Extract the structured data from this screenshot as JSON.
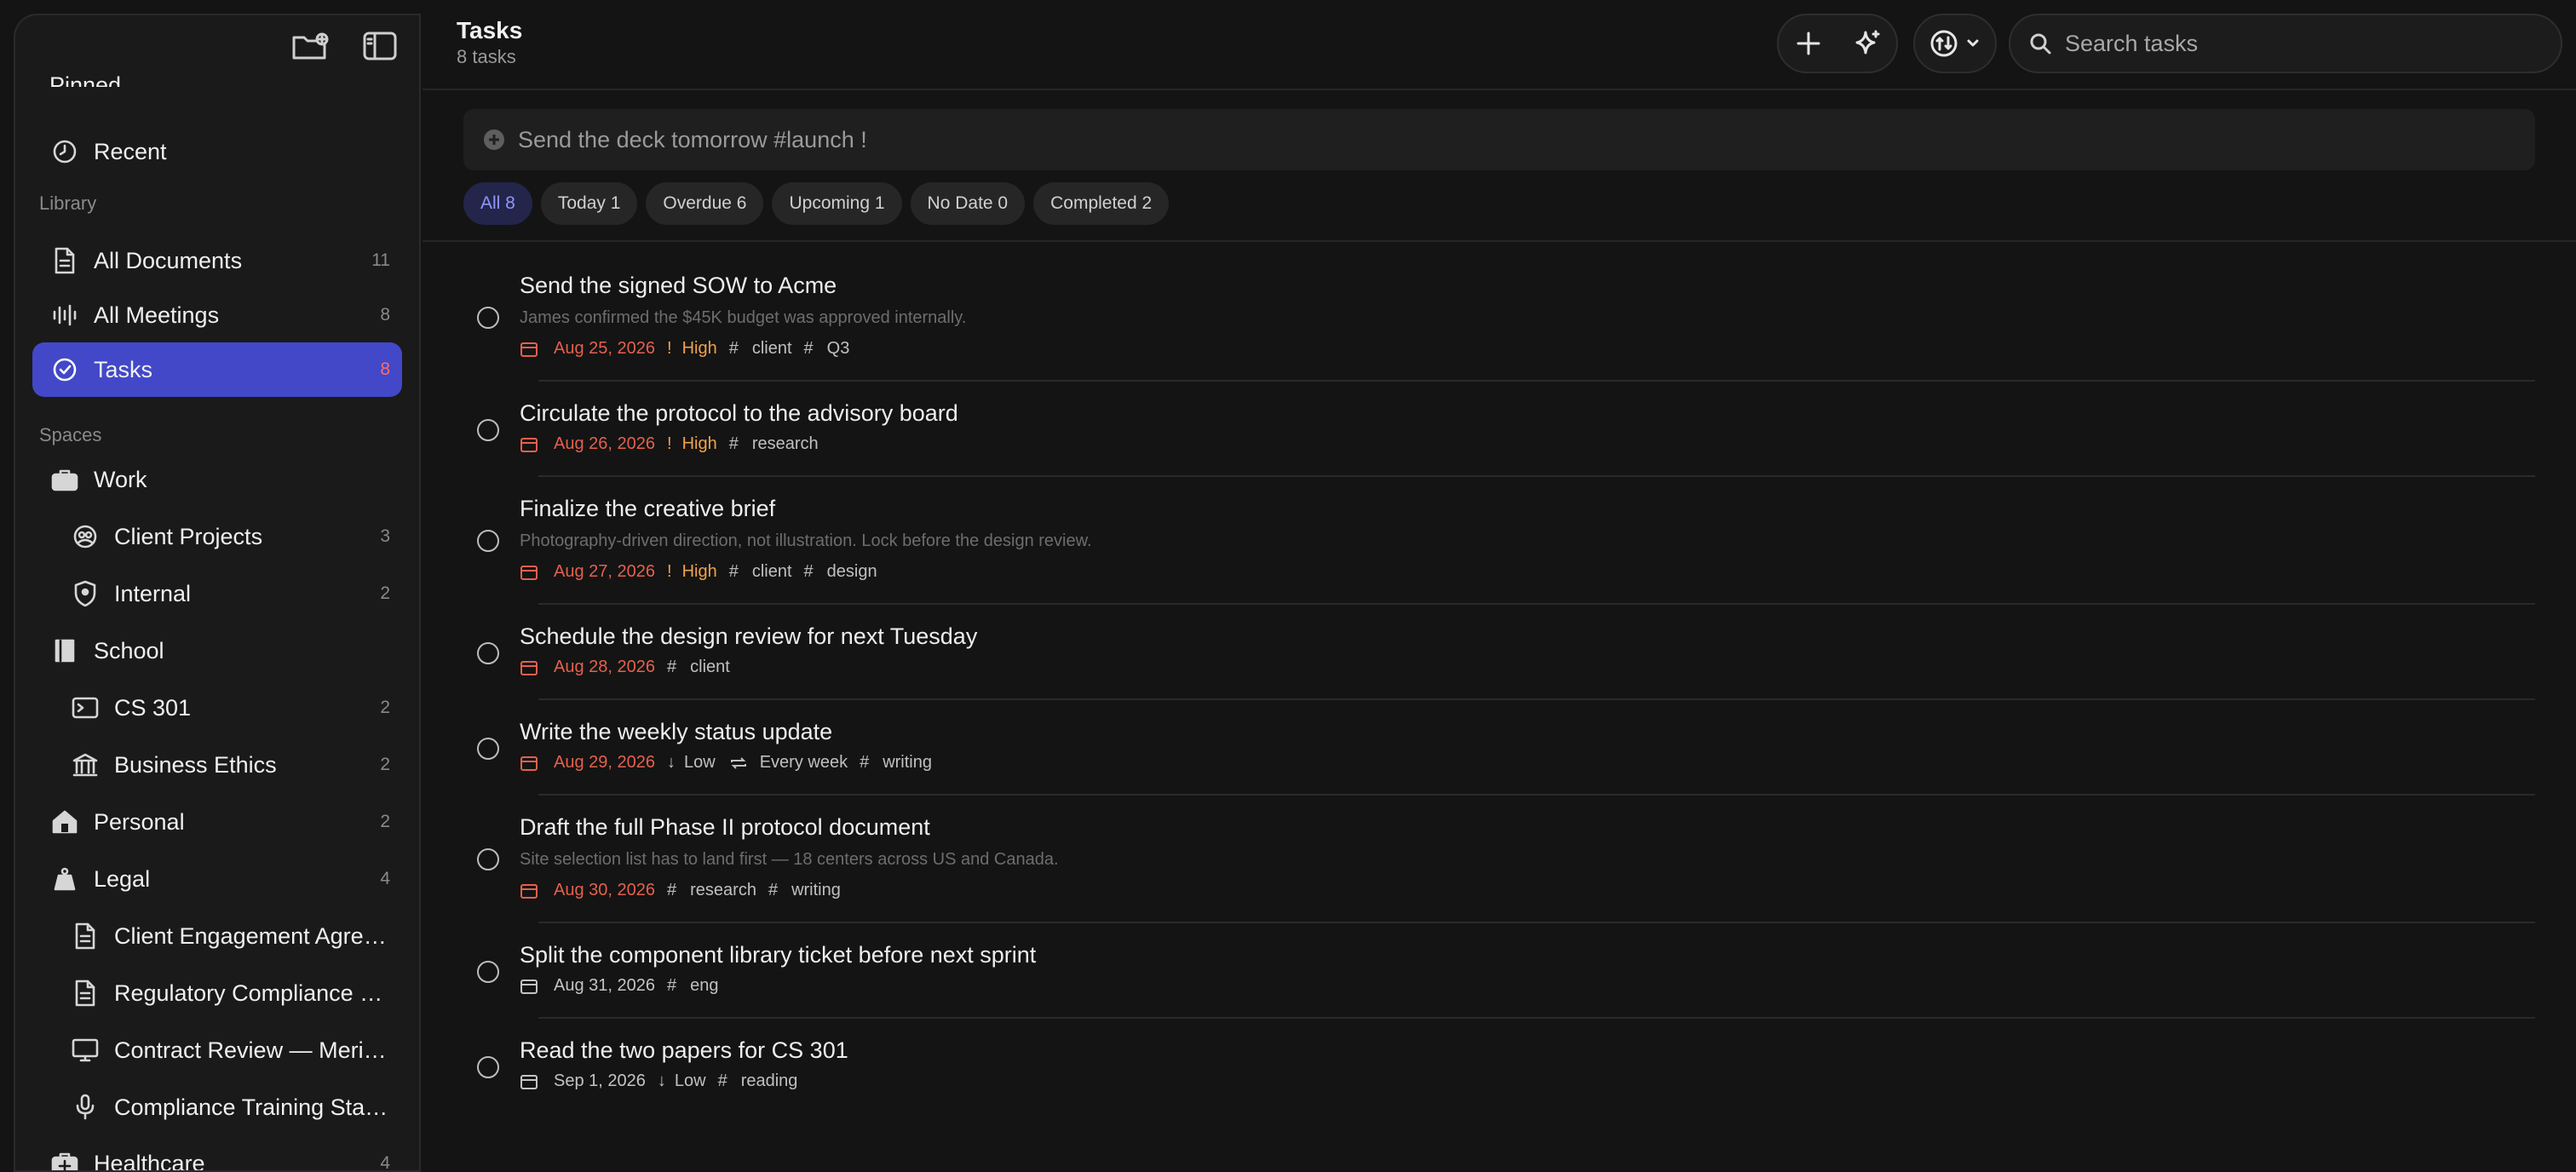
{
  "sidebar": {
    "top_partial_label": "Pinned",
    "recent": "Recent",
    "library_head": "Library",
    "library": [
      {
        "label": "All Documents",
        "count": "11"
      },
      {
        "label": "All Meetings",
        "count": "8"
      },
      {
        "label": "Tasks",
        "count": "8"
      }
    ],
    "spaces_head": "Spaces",
    "spaces": [
      {
        "label": "Work",
        "count": ""
      },
      {
        "label": "Client Projects",
        "count": "3"
      },
      {
        "label": "Internal",
        "count": "2"
      },
      {
        "label": "School",
        "count": ""
      },
      {
        "label": "CS 301",
        "count": "2"
      },
      {
        "label": "Business Ethics",
        "count": "2"
      },
      {
        "label": "Personal",
        "count": "2"
      },
      {
        "label": "Legal",
        "count": "4"
      },
      {
        "label": "Client Engagement Agreement",
        "count": ""
      },
      {
        "label": "Regulatory Compliance Checklist",
        "count": ""
      },
      {
        "label": "Contract Review — Meridian",
        "count": ""
      },
      {
        "label": "Compliance Training Standards",
        "count": ""
      },
      {
        "label": "Healthcare",
        "count": "4"
      }
    ]
  },
  "header": {
    "title": "Tasks",
    "subtitle": "8 tasks",
    "search_placeholder": "Search tasks"
  },
  "quick_add": {
    "text": "Send the deck tomorrow #launch !"
  },
  "filters": [
    "All 8",
    "Today 1",
    "Overdue 6",
    "Upcoming 1",
    "No Date 0",
    "Completed 2"
  ],
  "tasks": [
    {
      "title": "Send the signed SOW to Acme",
      "note": "James confirmed the $45K budget was approved internally.",
      "date": "Aug 25, 2026",
      "priority": "High",
      "tags": [
        "client",
        "Q3"
      ]
    },
    {
      "title": "Circulate the protocol to the advisory board",
      "date": "Aug 26, 2026",
      "priority": "High",
      "tags": [
        "research"
      ]
    },
    {
      "title": "Finalize the creative brief",
      "note": "Photography-driven direction, not illustration. Lock before the design review.",
      "date": "Aug 27, 2026",
      "priority": "High",
      "tags": [
        "client",
        "design"
      ]
    },
    {
      "title": "Schedule the design review for next Tuesday",
      "date": "Aug 28, 2026",
      "tags": [
        "client"
      ]
    },
    {
      "title": "Write the weekly status update",
      "date": "Aug 29, 2026",
      "priority": "Low",
      "repeat": "Every week",
      "tags": [
        "writing"
      ]
    },
    {
      "title": "Draft the full Phase II protocol document",
      "note": "Site selection list has to land first — 18 centers across US and Canada.",
      "date": "Aug 30, 2026",
      "tags": [
        "research",
        "writing"
      ]
    },
    {
      "title": "Split the component library ticket before next sprint",
      "date": "Aug 31, 2026",
      "tags": [
        "eng"
      ]
    },
    {
      "title": "Read the two papers for CS 301",
      "date": "Sep 1, 2026",
      "priority": "Low",
      "tags": [
        "reading"
      ]
    }
  ]
}
